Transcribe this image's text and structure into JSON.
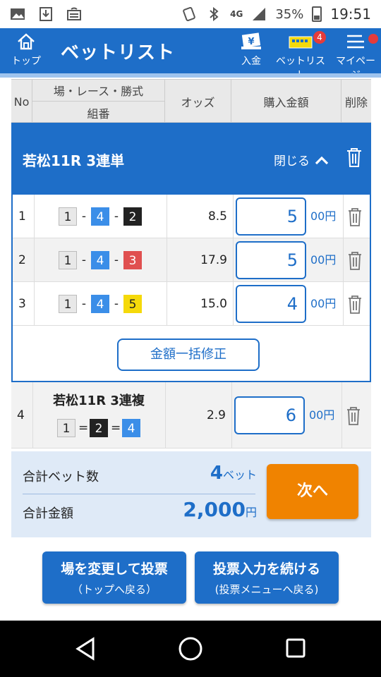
{
  "status": {
    "network": "4G",
    "battery": "35%",
    "time": "19:51"
  },
  "header": {
    "home_label": "トップ",
    "title": "ベットリスト",
    "deposit_label": "入金",
    "betlist_label": "ベットリスト",
    "betlist_badge": "4",
    "mypage_label": "マイページ"
  },
  "table_header": {
    "no": "No",
    "race": "場・レース・勝式",
    "combo": "組番",
    "odds": "オッズ",
    "amount": "購入金額",
    "delete": "削除"
  },
  "group": {
    "name": "若松11R 3連単",
    "close_label": "閉じる",
    "bulk_edit_label": "金額一括修正",
    "rows": [
      {
        "no": "1",
        "n1": "1",
        "n2": "4",
        "n3": "2",
        "sep": "-",
        "odds": "8.5",
        "amount": "5",
        "unit": "00円"
      },
      {
        "no": "2",
        "n1": "1",
        "n2": "4",
        "n3": "3",
        "sep": "-",
        "odds": "17.9",
        "amount": "5",
        "unit": "00円"
      },
      {
        "no": "3",
        "n1": "1",
        "n2": "4",
        "n3": "5",
        "sep": "-",
        "odds": "15.0",
        "amount": "4",
        "unit": "00円"
      }
    ]
  },
  "row4": {
    "no": "4",
    "name": "若松11R 3連複",
    "n1": "1",
    "n2": "2",
    "n3": "4",
    "sep": "=",
    "odds": "2.9",
    "amount": "6",
    "unit": "00円"
  },
  "summary": {
    "bets_label": "合計ベット数",
    "bets_value": "4",
    "bets_unit": "ベット",
    "total_label": "合計金額",
    "total_value": "2,000",
    "total_unit": "円",
    "next_label": "次へ"
  },
  "bottom": {
    "change_l1": "場を変更して投票",
    "change_l2": "（トップへ戻る）",
    "continue_l1": "投票入力を続ける",
    "continue_l2": "(投票メニューへ戻る)"
  },
  "colors": {
    "brand_blue": "#1e6ec8",
    "next_orange": "#f08300",
    "badge_red": "#e53b3b",
    "boat_1": "#e8e8e8",
    "boat_2": "#222222",
    "boat_3": "#e05050",
    "boat_4": "#3b8ee8",
    "boat_5": "#f5d90a"
  }
}
